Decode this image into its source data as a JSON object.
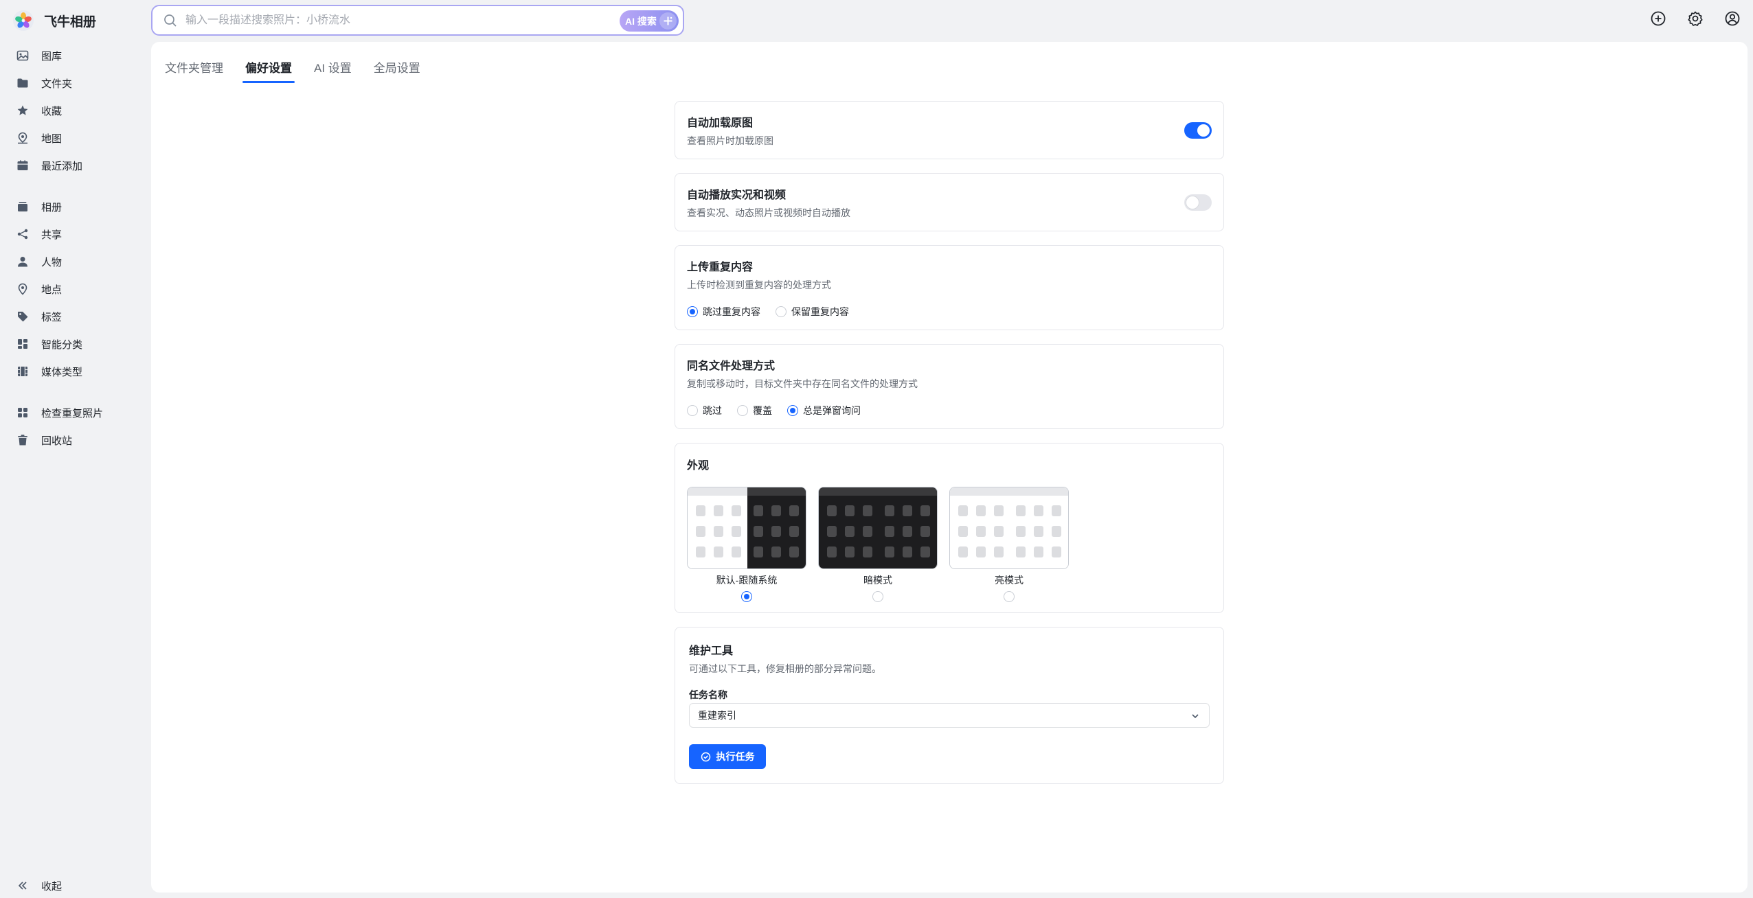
{
  "app": {
    "name": "飞牛相册"
  },
  "sidebar": {
    "group1": [
      {
        "label": "图库",
        "icon": "image-icon"
      },
      {
        "label": "文件夹",
        "icon": "folder-icon"
      },
      {
        "label": "收藏",
        "icon": "star-icon"
      },
      {
        "label": "地图",
        "icon": "map-pin-icon"
      },
      {
        "label": "最近添加",
        "icon": "calendar-icon"
      }
    ],
    "group2": [
      {
        "label": "相册",
        "icon": "album-icon"
      },
      {
        "label": "共享",
        "icon": "share-icon"
      },
      {
        "label": "人物",
        "icon": "person-icon"
      },
      {
        "label": "地点",
        "icon": "location-icon"
      },
      {
        "label": "标签",
        "icon": "tag-icon"
      },
      {
        "label": "智能分类",
        "icon": "smart-category-icon"
      },
      {
        "label": "媒体类型",
        "icon": "media-type-icon"
      }
    ],
    "group3": [
      {
        "label": "检查重复照片",
        "icon": "duplicate-icon"
      },
      {
        "label": "回收站",
        "icon": "trash-icon"
      }
    ],
    "collapse_label": "收起"
  },
  "search": {
    "placeholder": "输入一段描述搜索照片：小桥流水",
    "ai_button_label": "AI 搜索"
  },
  "tabs": [
    {
      "label": "文件夹管理",
      "active": false
    },
    {
      "label": "偏好设置",
      "active": true
    },
    {
      "label": "AI 设置",
      "active": false
    },
    {
      "label": "全局设置",
      "active": false
    }
  ],
  "settings": {
    "auto_load_original": {
      "title": "自动加载原图",
      "desc": "查看照片时加载原图",
      "enabled": true
    },
    "auto_play": {
      "title": "自动播放实况和视频",
      "desc": "查看实况、动态照片或视频时自动播放",
      "enabled": false
    },
    "duplicate_upload": {
      "title": "上传重复内容",
      "desc": "上传时检测到重复内容的处理方式",
      "options": [
        "跳过重复内容",
        "保留重复内容"
      ],
      "selected": 0
    },
    "same_name": {
      "title": "同名文件处理方式",
      "desc": "复制或移动时，目标文件夹中存在同名文件的处理方式",
      "options": [
        "跳过",
        "覆盖",
        "总是弹窗询问"
      ],
      "selected": 2
    },
    "appearance": {
      "title": "外观",
      "options": [
        "默认-跟随系统",
        "暗模式",
        "亮模式"
      ],
      "selected": 0
    },
    "maintenance": {
      "title": "维护工具",
      "desc": "可通过以下工具，修复相册的部分异常问题。",
      "task_label": "任务名称",
      "task_value": "重建索引",
      "run_label": "执行任务"
    }
  },
  "colors": {
    "accent": "#1664ff",
    "search_border": "#a9a6f2",
    "background": "#f1f2f4"
  }
}
